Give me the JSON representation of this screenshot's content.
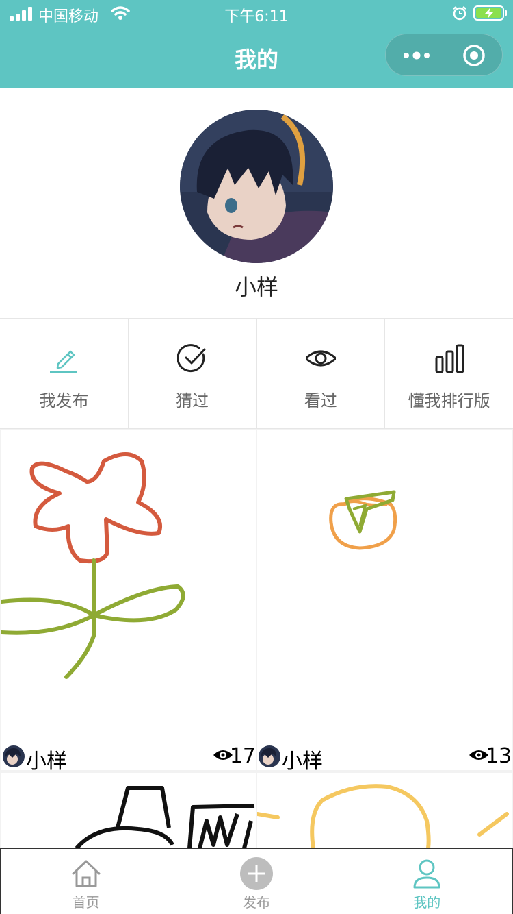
{
  "status_bar": {
    "carrier": "中国移动",
    "time": "下午6:11"
  },
  "nav": {
    "title": "我的"
  },
  "profile": {
    "name": "小样"
  },
  "menu": [
    {
      "label": "我发布",
      "icon": "pencil-icon"
    },
    {
      "label": "猜过",
      "icon": "check-circle-icon"
    },
    {
      "label": "看过",
      "icon": "eye-icon"
    },
    {
      "label": "懂我排行版",
      "icon": "bar-chart-icon"
    }
  ],
  "cards": [
    {
      "user": "小样",
      "views": "17",
      "drawing": "flower"
    },
    {
      "user": "小样",
      "views": "13",
      "drawing": "orange"
    },
    {
      "drawing": "hat"
    },
    {
      "drawing": "sun"
    }
  ],
  "tabs": [
    {
      "label": "首页",
      "icon": "home-icon"
    },
    {
      "label": "发布",
      "icon": "plus-circle-icon"
    },
    {
      "label": "我的",
      "icon": "user-icon",
      "active": true
    }
  ],
  "colors": {
    "accent": "#5ec5c2"
  }
}
